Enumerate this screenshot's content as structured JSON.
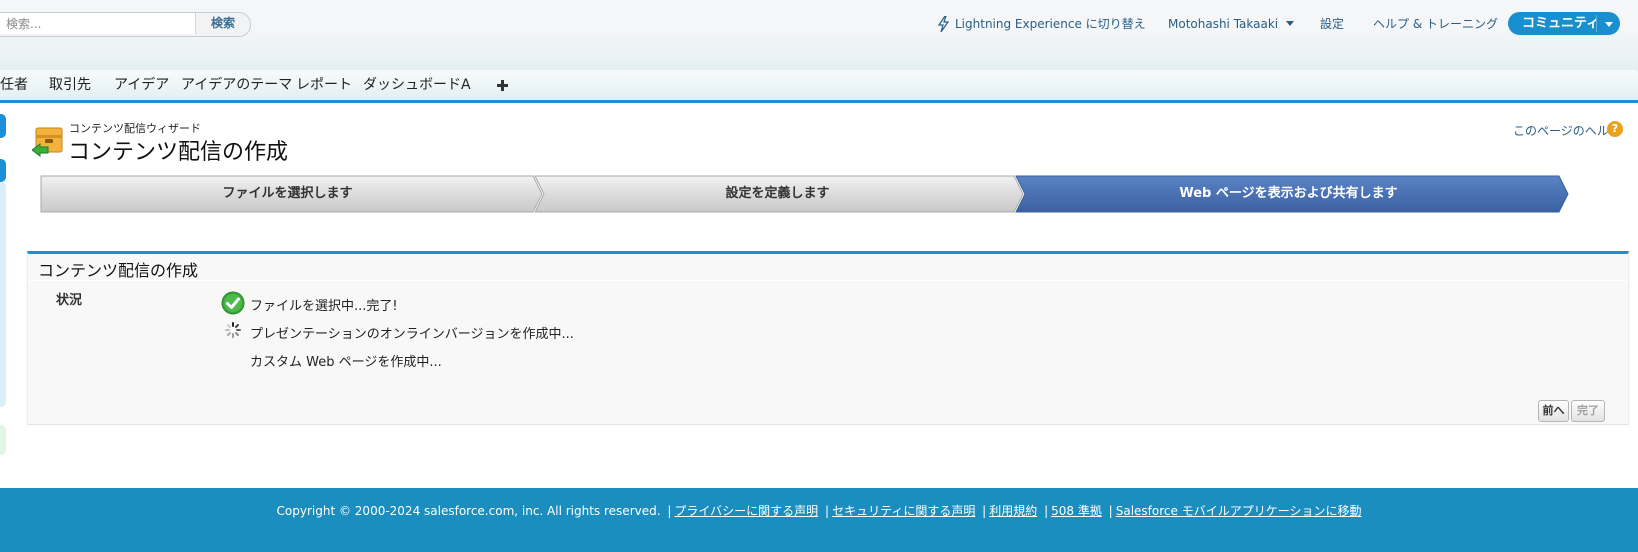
{
  "header": {
    "search_placeholder": "検索...",
    "search_button": "検索",
    "lightning_link": "Lightning Experience に切り替え",
    "user_menu": "Motohashi Takaaki",
    "setup_link": "設定",
    "help_training_link": "ヘルプ & トレーニング",
    "community_button": "コミュニティ"
  },
  "tabs": [
    "任者",
    "取引先",
    "アイデア",
    "アイデアのテーマ",
    "レポート",
    "ダッシュボード",
    "A"
  ],
  "add_tab_icon": "plus-icon",
  "page": {
    "wizard_name": "コンテンツ配信ウィザード",
    "title": "コンテンツ配信の作成",
    "help_link": "このページのヘルプ",
    "help_icon": "?"
  },
  "steps": [
    {
      "label": "ファイルを選択します",
      "active": false
    },
    {
      "label": "設定を定義します",
      "active": false
    },
    {
      "label": "Web ページを表示および共有します",
      "active": true
    }
  ],
  "section": {
    "title": "コンテンツ配信の作成",
    "status_label": "状況",
    "status_lines": [
      {
        "text": "ファイルを選択中...完了!",
        "icon": "check-icon"
      },
      {
        "text": "プレゼンテーションのオンラインバージョンを作成中...",
        "icon": "spinner-icon"
      },
      {
        "text": "カスタム Web ページを作成中...",
        "icon": ""
      }
    ],
    "prev_button": "前へ",
    "done_button": "完了"
  },
  "footer": {
    "copyright": "Copyright © 2000-2024 salesforce.com, inc. All rights reserved.",
    "links": [
      "プライバシーに関する声明",
      "セキュリティに関する声明",
      "利用規約",
      "508 準拠",
      "Salesforce モバイルアプリケーションに移動"
    ]
  },
  "colors": {
    "accent_blue": "#1d8fd6",
    "footer_blue": "#1c8dbf",
    "active_step": "#4a72b4",
    "link": "#2a5e86",
    "success_green": "#3aa33a"
  }
}
